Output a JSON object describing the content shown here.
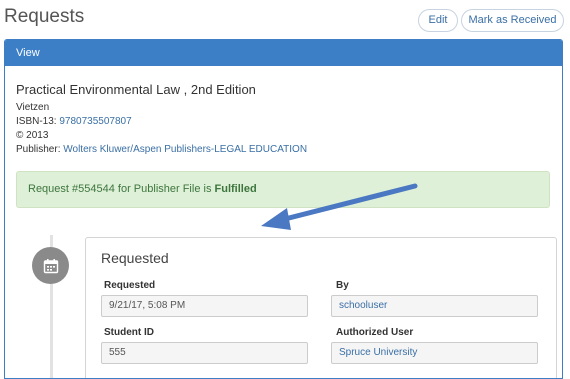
{
  "header": {
    "title": "Requests",
    "edit_label": "Edit",
    "mark_received_label": "Mark as Received"
  },
  "panel": {
    "header_label": "View",
    "book": {
      "title": "Practical Environmental Law , 2nd Edition",
      "author": "Vietzen",
      "isbn_label": "ISBN-13: ",
      "isbn": "9780735507807",
      "copyright": "© 2013",
      "publisher_label": "Publisher: ",
      "publisher": "Wolters Kluwer/Aspen Publishers-LEGAL EDUCATION"
    },
    "alert": {
      "text": "Request #554544 for Publisher File is ",
      "status": "Fulfilled"
    }
  },
  "card": {
    "title": "Requested",
    "requested_label": "Requested",
    "requested_value": "9/21/17, 5:08 PM",
    "by_label": "By",
    "by_value": "schooluser",
    "student_id_label": "Student ID",
    "student_id_value": "555",
    "authorized_user_label": "Authorized User",
    "authorized_user_value": "Spruce University"
  },
  "icons": {
    "timeline": "calendar-icon",
    "annotation": "arrow-icon"
  },
  "colors": {
    "panel_header": "#3d7fc7",
    "alert_bg": "#dff0d8",
    "alert_text": "#3c763d",
    "link": "#3a6fa5",
    "annotation_arrow": "#4a78c2"
  }
}
